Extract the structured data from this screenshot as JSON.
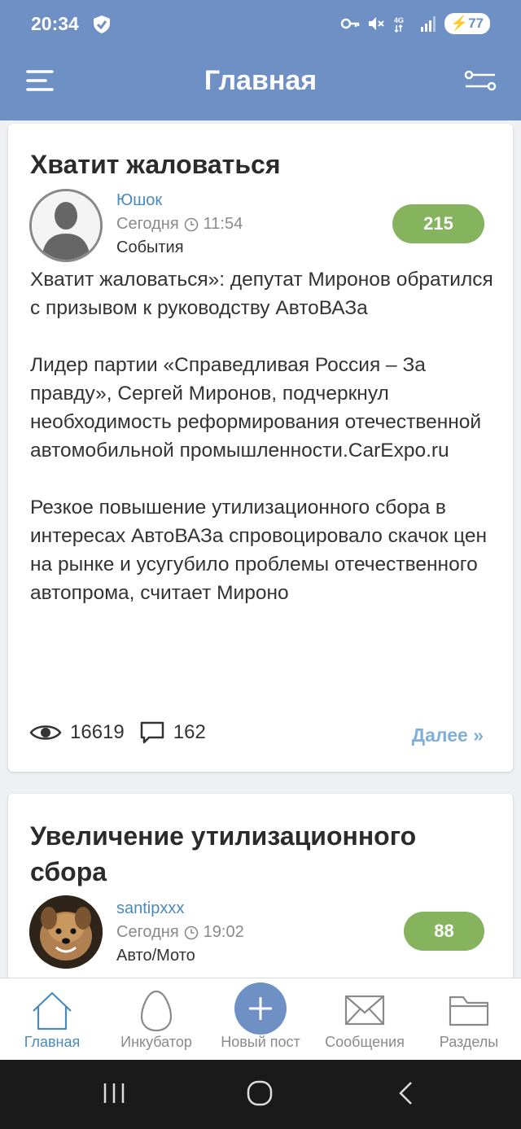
{
  "status": {
    "time": "20:34",
    "battery": "77",
    "net": "4G"
  },
  "header": {
    "title": "Главная"
  },
  "posts": [
    {
      "title": "Хватит жаловаться",
      "author": "Юшок",
      "date": "Сегодня",
      "time": "11:54",
      "category": "События",
      "rating": "215",
      "paragraphs": [
        "Хватит жаловаться»: депутат Миронов обратился с призывом к руководству АвтоВАЗа",
        "Лидер партии «Справедливая Россия – За правду», Сергей Миронов, подчеркнул необходимость реформирования отечественной автомобильной промышленности.CarExpo.ru",
        "Резкое повышение утилизационного сбора в интересах АвтоВАЗа спровоцировало скачок цен на рынке и усугубило проблемы отечественного автопрома, считает Мироно"
      ],
      "views": "16619",
      "comments": "162",
      "more": "Далее »"
    },
    {
      "title": "Увеличение утилизационного сбора",
      "author": "santipxxx",
      "date": "Сегодня",
      "time": "19:02",
      "category": "Авто/Мото",
      "rating": "88"
    }
  ],
  "tabs": [
    {
      "label": "Главная",
      "icon": "home-icon"
    },
    {
      "label": "Инкубатор",
      "icon": "egg-icon"
    },
    {
      "label": "Новый пост",
      "icon": "plus-icon"
    },
    {
      "label": "Сообщения",
      "icon": "envelope-icon"
    },
    {
      "label": "Разделы",
      "icon": "folder-icon"
    }
  ],
  "colors": {
    "accent": "#6e90c4",
    "rating": "#86b35e",
    "link": "#4a8ab8"
  }
}
